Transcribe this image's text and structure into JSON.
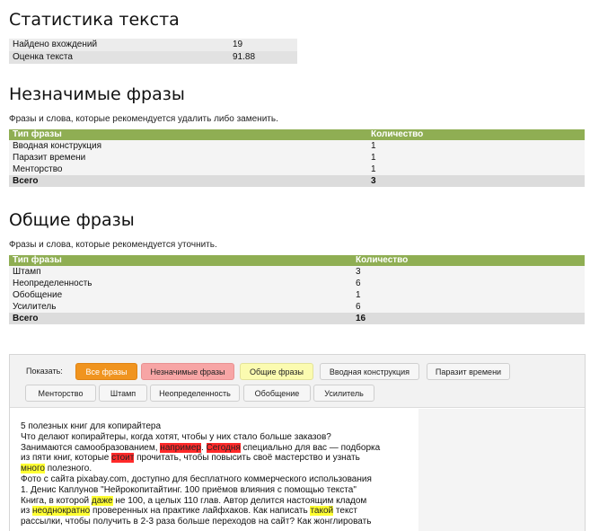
{
  "stats": {
    "title": "Статистика текста",
    "rows": [
      {
        "label": "Найдено вхождений",
        "value": "19"
      },
      {
        "label": "Оценка текста",
        "value": "91.88"
      }
    ]
  },
  "insignificant": {
    "title": "Незначимые фразы",
    "description": "Фразы и слова, которые рекомендуется удалить либо заменить.",
    "col_type": "Тип фразы",
    "col_count": "Количество",
    "rows": [
      {
        "type": "Вводная конструкция",
        "count": "1"
      },
      {
        "type": "Паразит времени",
        "count": "1"
      },
      {
        "type": "Менторство",
        "count": "1"
      }
    ],
    "total_label": "Всего",
    "total_value": "3"
  },
  "common": {
    "title": "Общие фразы",
    "description": "Фразы и слова, которые рекомендуется уточнить.",
    "col_type": "Тип фразы",
    "col_count": "Количество",
    "rows": [
      {
        "type": "Штамп",
        "count": "3"
      },
      {
        "type": "Неопределенность",
        "count": "6"
      },
      {
        "type": "Обобщение",
        "count": "1"
      },
      {
        "type": "Усилитель",
        "count": "6"
      }
    ],
    "total_label": "Всего",
    "total_value": "16"
  },
  "filters": {
    "show_label": "Показать:",
    "buttons": [
      "Все фразы",
      "Незначимые фразы",
      "Общие фразы",
      "Вводная конструкция",
      "Паразит времени",
      "Менторство",
      "Штамп",
      "Неопределенность",
      "Обобщение",
      "Усилитель"
    ]
  },
  "text": {
    "l1": "5 полезных книг для копирайтера",
    "l2": "Что делают копирайтеры, когда хотят, чтобы у них стало больше заказов?",
    "l3a": "Занимаются самообразованием, ",
    "l3h1": "например",
    "l3b": ". ",
    "l3h2": "Сегодня",
    "l3c": " специально для вас — подборка",
    "l4a": "из пяти книг, которые ",
    "l4h": "стоит",
    "l4b": " прочитать, чтобы повысить своё мастерство и узнать",
    "l5h": "много",
    "l5b": " полезного.",
    "l6": "Фото с сайта pixabay.com, доступно для бесплатного коммерческого использования",
    "l7": "1. Денис Каплунов \"Нейрокопитайтинг. 100 приёмов влияния с помощью текста\"",
    "l8a": "Книга, в которой ",
    "l8h": "даже",
    "l8b": " не 100, а целых 110 глав. Автор делится настоящим кладом",
    "l9a": "из ",
    "l9h1": "неоднократно",
    "l9b": " проверенных на практике лайфхаков. Как написать ",
    "l9h2": "такой",
    "l9c": " текст",
    "l10": "рассылки, чтобы получить в 2-3 раза больше переходов на сайт? Как жонглировать"
  },
  "colors": {
    "table_header": "#8fae53",
    "all_button": "#f0941f",
    "insignificant_button": "#f7a5a5",
    "common_button": "#fbfbb0",
    "highlight_red": "#ff2a2a",
    "highlight_yellow": "#ffff33"
  }
}
